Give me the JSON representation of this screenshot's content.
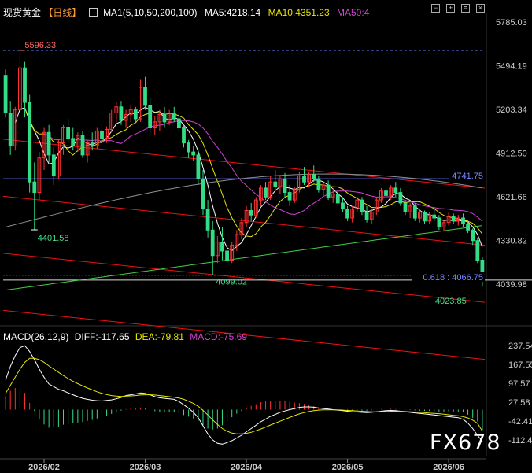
{
  "header": {
    "symbol": "现货黄金",
    "period": "【日线】",
    "ma_label": "MA1(5,10,50,200,100)",
    "ma5": "MA5:4218.14",
    "ma10": "MA10:4351.23",
    "ma50": "MA50:4",
    "icons": [
      "minus-icon",
      "plus-icon",
      "settings-icon",
      "close-icon"
    ]
  },
  "macd_header": {
    "label": "MACD(26,12,9)",
    "diff": "DIFF:-117.65",
    "dea": "DEA:-79.81",
    "macd": "MACD:-75.69"
  },
  "watermark": "FX678",
  "colors": {
    "up": "#ff3333",
    "down": "#33dd88",
    "ma5": "#ffffff",
    "ma10": "#e6e600",
    "ma50": "#cc44cc",
    "ma100": "#909090",
    "ma200": "#44cc44",
    "channel": "#ee1111",
    "hline": "#6677ff"
  },
  "chart_data": [
    {
      "type": "candlestick",
      "y_axis_ticks": [
        5785.03,
        5494.19,
        5203.34,
        4912.5,
        4621.66,
        4330.82,
        4039.98
      ],
      "y_tick_labels": [
        "5785.03",
        "5494.19",
        "5203.34",
        "4912.50",
        "4621.66",
        "4330.82",
        "4039.98"
      ],
      "x_tick_labels": [
        "2026/02",
        "2026/03",
        "2026/04",
        "2026/05",
        "2026/06"
      ],
      "annotations": {
        "high": "5596.33",
        "low1": "4401.58",
        "low2": "4099.02",
        "hline1": "4741.75",
        "fib": "0.618 : 4066.75",
        "low3": "4023.85"
      },
      "candles": [
        [
          5430,
          5470,
          5150,
          5180
        ],
        [
          5180,
          5260,
          4900,
          4960
        ],
        [
          4960,
          5220,
          4930,
          5200
        ],
        [
          5200,
          5596.33,
          5180,
          5480
        ],
        [
          5480,
          5520,
          5150,
          5250
        ],
        [
          5250,
          5300,
          4650,
          4720
        ],
        [
          4720,
          4850,
          4401.58,
          4650
        ],
        [
          4650,
          4920,
          4600,
          4880
        ],
        [
          4880,
          5080,
          4800,
          5050
        ],
        [
          5050,
          5100,
          4850,
          4900
        ],
        [
          4900,
          4950,
          4700,
          4760
        ],
        [
          4760,
          5000,
          4740,
          4980
        ],
        [
          4980,
          5100,
          4900,
          5080
        ],
        [
          5080,
          5140,
          4980,
          5010
        ],
        [
          5010,
          5080,
          4930,
          4960
        ],
        [
          4960,
          5050,
          4920,
          5030
        ],
        [
          5030,
          5060,
          4880,
          4900
        ],
        [
          4900,
          5000,
          4850,
          4980
        ],
        [
          4980,
          5050,
          4930,
          4960
        ],
        [
          4960,
          5080,
          4940,
          5060
        ],
        [
          5060,
          5100,
          4990,
          5010
        ],
        [
          5010,
          5090,
          4980,
          5070
        ],
        [
          5070,
          5200,
          5050,
          5180
        ],
        [
          5180,
          5250,
          5120,
          5220
        ],
        [
          5220,
          5260,
          5100,
          5130
        ],
        [
          5130,
          5200,
          5080,
          5170
        ],
        [
          5170,
          5230,
          5120,
          5200
        ],
        [
          5200,
          5220,
          5120,
          5140
        ],
        [
          5140,
          5400,
          5120,
          5350
        ],
        [
          5350,
          5420,
          5200,
          5230
        ],
        [
          5230,
          5280,
          5050,
          5080
        ],
        [
          5080,
          5160,
          5030,
          5120
        ],
        [
          5120,
          5200,
          5060,
          5170
        ],
        [
          5170,
          5220,
          5080,
          5120
        ],
        [
          5120,
          5200,
          5100,
          5180
        ],
        [
          5180,
          5220,
          5120,
          5140
        ],
        [
          5140,
          5180,
          5060,
          5080
        ],
        [
          5080,
          5100,
          4950,
          4980
        ],
        [
          4980,
          5000,
          4880,
          4920
        ],
        [
          4920,
          4960,
          4860,
          4900
        ],
        [
          4900,
          4930,
          4700,
          4740
        ],
        [
          4740,
          4800,
          4500,
          4540
        ],
        [
          4540,
          4600,
          4350,
          4400
        ],
        [
          4400,
          4460,
          4099.02,
          4230
        ],
        [
          4230,
          4360,
          4180,
          4320
        ],
        [
          4320,
          4420,
          4200,
          4260
        ],
        [
          4260,
          4300,
          4160,
          4200
        ],
        [
          4200,
          4320,
          4180,
          4300
        ],
        [
          4300,
          4400,
          4260,
          4370
        ],
        [
          4370,
          4480,
          4340,
          4450
        ],
        [
          4450,
          4560,
          4420,
          4530
        ],
        [
          4530,
          4580,
          4460,
          4500
        ],
        [
          4500,
          4620,
          4480,
          4600
        ],
        [
          4600,
          4700,
          4560,
          4680
        ],
        [
          4680,
          4720,
          4600,
          4620
        ],
        [
          4620,
          4760,
          4600,
          4720
        ],
        [
          4720,
          4800,
          4660,
          4690
        ],
        [
          4690,
          4760,
          4640,
          4740
        ],
        [
          4740,
          4780,
          4620,
          4650
        ],
        [
          4650,
          4700,
          4560,
          4600
        ],
        [
          4600,
          4690,
          4580,
          4670
        ],
        [
          4670,
          4790,
          4650,
          4760
        ],
        [
          4760,
          4820,
          4700,
          4720
        ],
        [
          4720,
          4790,
          4690,
          4770
        ],
        [
          4770,
          4830,
          4720,
          4740
        ],
        [
          4740,
          4760,
          4650,
          4670
        ],
        [
          4670,
          4720,
          4630,
          4700
        ],
        [
          4700,
          4730,
          4600,
          4620
        ],
        [
          4620,
          4680,
          4580,
          4640
        ],
        [
          4640,
          4660,
          4560,
          4580
        ],
        [
          4580,
          4620,
          4520,
          4540
        ],
        [
          4540,
          4560,
          4460,
          4480
        ],
        [
          4480,
          4560,
          4450,
          4540
        ],
        [
          4540,
          4620,
          4520,
          4600
        ],
        [
          4600,
          4620,
          4500,
          4520
        ],
        [
          4520,
          4560,
          4450,
          4470
        ],
        [
          4470,
          4540,
          4440,
          4520
        ],
        [
          4520,
          4620,
          4500,
          4600
        ],
        [
          4600,
          4680,
          4580,
          4660
        ],
        [
          4660,
          4700,
          4610,
          4630
        ],
        [
          4630,
          4700,
          4600,
          4680
        ],
        [
          4680,
          4720,
          4620,
          4650
        ],
        [
          4650,
          4680,
          4560,
          4580
        ],
        [
          4580,
          4600,
          4500,
          4520
        ],
        [
          4520,
          4580,
          4480,
          4560
        ],
        [
          4560,
          4580,
          4460,
          4480
        ],
        [
          4480,
          4540,
          4450,
          4520
        ],
        [
          4520,
          4530,
          4440,
          4460
        ],
        [
          4460,
          4520,
          4440,
          4500
        ],
        [
          4500,
          4540,
          4460,
          4480
        ],
        [
          4480,
          4500,
          4400,
          4420
        ],
        [
          4420,
          4470,
          4390,
          4450
        ],
        [
          4450,
          4520,
          4430,
          4490
        ],
        [
          4490,
          4510,
          4440,
          4460
        ],
        [
          4460,
          4500,
          4430,
          4480
        ],
        [
          4480,
          4510,
          4420,
          4440
        ],
        [
          4440,
          4470,
          4380,
          4400
        ],
        [
          4400,
          4410,
          4300,
          4330
        ],
        [
          4330,
          4350,
          4180,
          4200
        ],
        [
          4200,
          4220,
          4023.85,
          4066.75
        ]
      ]
    },
    {
      "type": "macd",
      "y_axis_ticks": [
        237.54,
        167.55,
        97.57,
        27.58,
        -42.41,
        -112.4
      ],
      "y_tick_labels": [
        "237.54",
        "167.55",
        "97.57",
        "27.58",
        "-42.41",
        "-112.40"
      ],
      "diff": [
        110,
        160,
        200,
        230,
        237,
        215,
        185,
        150,
        120,
        95,
        85,
        75,
        70,
        62,
        55,
        48,
        42,
        38,
        35,
        33,
        32,
        34,
        36,
        40,
        45,
        52,
        55,
        58,
        62,
        60,
        55,
        48,
        44,
        42,
        40,
        38,
        30,
        18,
        5,
        -10,
        -30,
        -60,
        -90,
        -112,
        -125,
        -128,
        -122,
        -115,
        -105,
        -95,
        -82,
        -70,
        -58,
        -45,
        -35,
        -25,
        -18,
        -10,
        -5,
        0,
        4,
        8,
        10,
        10,
        9,
        6,
        4,
        2,
        0,
        -2,
        -4,
        -6,
        -8,
        -9,
        -10,
        -11,
        -10,
        -8,
        -6,
        -4,
        -3,
        -4,
        -6,
        -8,
        -10,
        -12,
        -14,
        -16,
        -18,
        -20,
        -22,
        -24,
        -26,
        -28,
        -30,
        -36,
        -50,
        -70,
        -95,
        -117.65
      ],
      "dea": [
        60,
        90,
        120,
        150,
        175,
        190,
        190,
        185,
        175,
        162,
        150,
        138,
        126,
        115,
        105,
        96,
        88,
        80,
        73,
        66,
        60,
        56,
        52,
        50,
        49,
        50,
        51,
        52,
        54,
        55,
        55,
        54,
        52,
        50,
        48,
        46,
        43,
        38,
        31,
        23,
        12,
        -3,
        -20,
        -38,
        -55,
        -70,
        -80,
        -87,
        -90,
        -90,
        -88,
        -84,
        -78,
        -72,
        -65,
        -57,
        -50,
        -43,
        -36,
        -29,
        -22,
        -16,
        -11,
        -7,
        -4,
        -2,
        -1,
        -1,
        -1,
        -1,
        -2,
        -3,
        -4,
        -5,
        -6,
        -7,
        -8,
        -8,
        -8,
        -7,
        -6,
        -6,
        -6,
        -7,
        -8,
        -9,
        -10,
        -11,
        -13,
        -14,
        -15,
        -17,
        -19,
        -21,
        -23,
        -26,
        -31,
        -39,
        -51,
        -79.81
      ],
      "hist": [
        50,
        70,
        80,
        80,
        62,
        25,
        -5,
        -35,
        -55,
        -67,
        -65,
        -63,
        -56,
        -53,
        -50,
        -48,
        -46,
        -42,
        -38,
        -33,
        -28,
        -22,
        -16,
        -10,
        -4,
        2,
        4,
        6,
        8,
        5,
        0,
        -6,
        -8,
        -8,
        -8,
        -8,
        -13,
        -20,
        -26,
        -33,
        -42,
        -57,
        -70,
        -74,
        -70,
        -58,
        -42,
        -28,
        -15,
        -5,
        6,
        14,
        20,
        27,
        30,
        32,
        32,
        33,
        31,
        29,
        26,
        24,
        21,
        17,
        13,
        8,
        5,
        3,
        1,
        -1,
        -2,
        -3,
        -4,
        -4,
        -4,
        -4,
        -2,
        0,
        2,
        3,
        3,
        2,
        0,
        -1,
        -2,
        -3,
        -4,
        -5,
        -5,
        -6,
        -7,
        -7,
        -7,
        -7,
        -7,
        -10,
        -19,
        -31,
        -44,
        -75.69
      ]
    }
  ]
}
